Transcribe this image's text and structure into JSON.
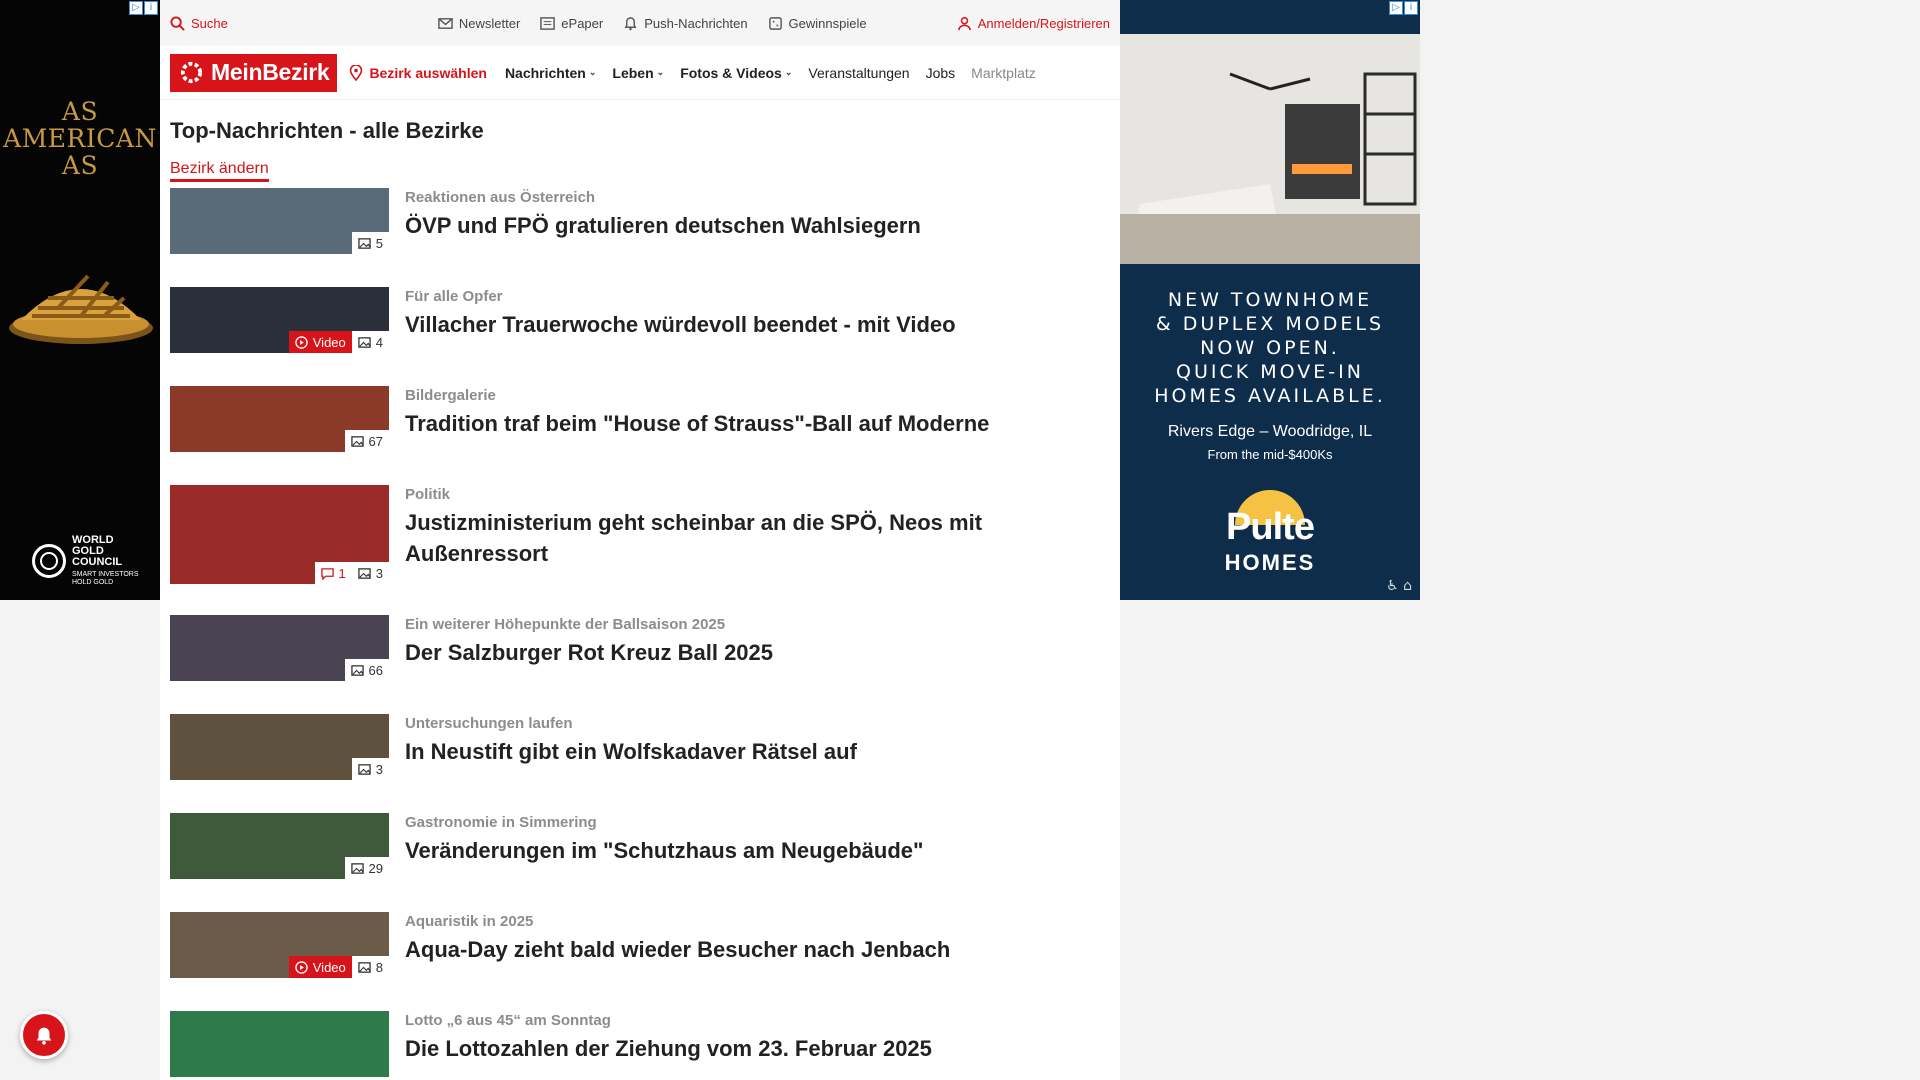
{
  "colors": {
    "brand": "#d7141a",
    "kicker": "#8c8c8c",
    "ad_right_bg": "#0d2d4a",
    "ad_left_bg": "#050505"
  },
  "ad_left": {
    "headline_lines": [
      "AS",
      "AMERICAN",
      "AS"
    ],
    "brand_lines": [
      "WORLD",
      "GOLD",
      "COUNCIL"
    ],
    "tagline_lines": [
      "SMART INVESTORS",
      "HOLD GOLD"
    ],
    "corner": [
      "▷",
      "i"
    ]
  },
  "topbar": {
    "search": "Suche",
    "newsletter": "Newsletter",
    "epaper": "ePaper",
    "push": "Push-Nachrichten",
    "gewinnspiele": "Gewinnspiele",
    "login": "Anmelden/Registrieren"
  },
  "navbar": {
    "logo": "MeinBezirk",
    "bezirk": "Bezirk auswählen",
    "links": [
      "Nachrichten",
      "Leben",
      "Fotos & Videos",
      "Veranstaltungen",
      "Jobs",
      "Marktplatz"
    ]
  },
  "page": {
    "title": "Top-Nachrichten - alle Bezirke",
    "change_bezirk": "Bezirk ändern"
  },
  "video_label": "Video",
  "articles": [
    {
      "kicker": "Reaktionen aus Österreich",
      "title": "ÖVP und FPÖ gratulieren deutschen Wahlsiegern",
      "photos": "5",
      "thumb": "#5a6b78"
    },
    {
      "kicker": "Für alle Opfer",
      "title": "Villacher Trauerwoche würdevoll beendet - mit Video",
      "photos": "4",
      "thumb": "#2b2f3a"
    },
    {
      "kicker": "Bildergalerie",
      "title": "Tradition traf beim \"House of Strauss\"-Ball auf Moderne",
      "photos": "67",
      "thumb": "#8b3a2a"
    },
    {
      "kicker": "Politik",
      "title": "Justizministerium geht scheinbar an die SPÖ, Neos mit Außenressort",
      "photos": "3",
      "comments": "1",
      "thumb": "#9a2b28"
    },
    {
      "kicker": "Ein weiterer Höhepunkte der Ballsaison 2025",
      "title": "Der Salzburger Rot Kreuz Ball 2025",
      "photos": "66",
      "thumb": "#4a4452"
    },
    {
      "kicker": "Untersuchungen laufen",
      "title": "In Neustift gibt ein Wolfskadaver Rätsel auf",
      "photos": "3",
      "thumb": "#5e523f"
    },
    {
      "kicker": "Gastronomie in Simmering",
      "title": "Veränderungen im \"Schutzhaus am Neugebäude\"",
      "photos": "29",
      "thumb": "#3f5a3a"
    },
    {
      "kicker": "Aquaristik in 2025",
      "title": "Aqua-Day zieht bald wieder Besucher nach Jenbach",
      "photos": "8",
      "thumb": "#6b5c4a"
    },
    {
      "kicker": "Lotto „6 aus 45“ am Sonntag",
      "title": "Die Lottozahlen der Ziehung vom 23. Februar 2025",
      "photos": "",
      "thumb": "#2f7a4a"
    }
  ],
  "ad_right": {
    "copy_lines": [
      "NEW TOWNHOME",
      "& DUPLEX MODELS",
      "NOW OPEN.",
      "QUICK MOVE-IN",
      "HOMES AVAILABLE."
    ],
    "location": "Rivers Edge – Woodridge, IL",
    "price": "From the mid-$400Ks",
    "brand_word": "Pulte",
    "brand_sub": "HOMES",
    "corner": [
      "▷",
      "i"
    ]
  }
}
